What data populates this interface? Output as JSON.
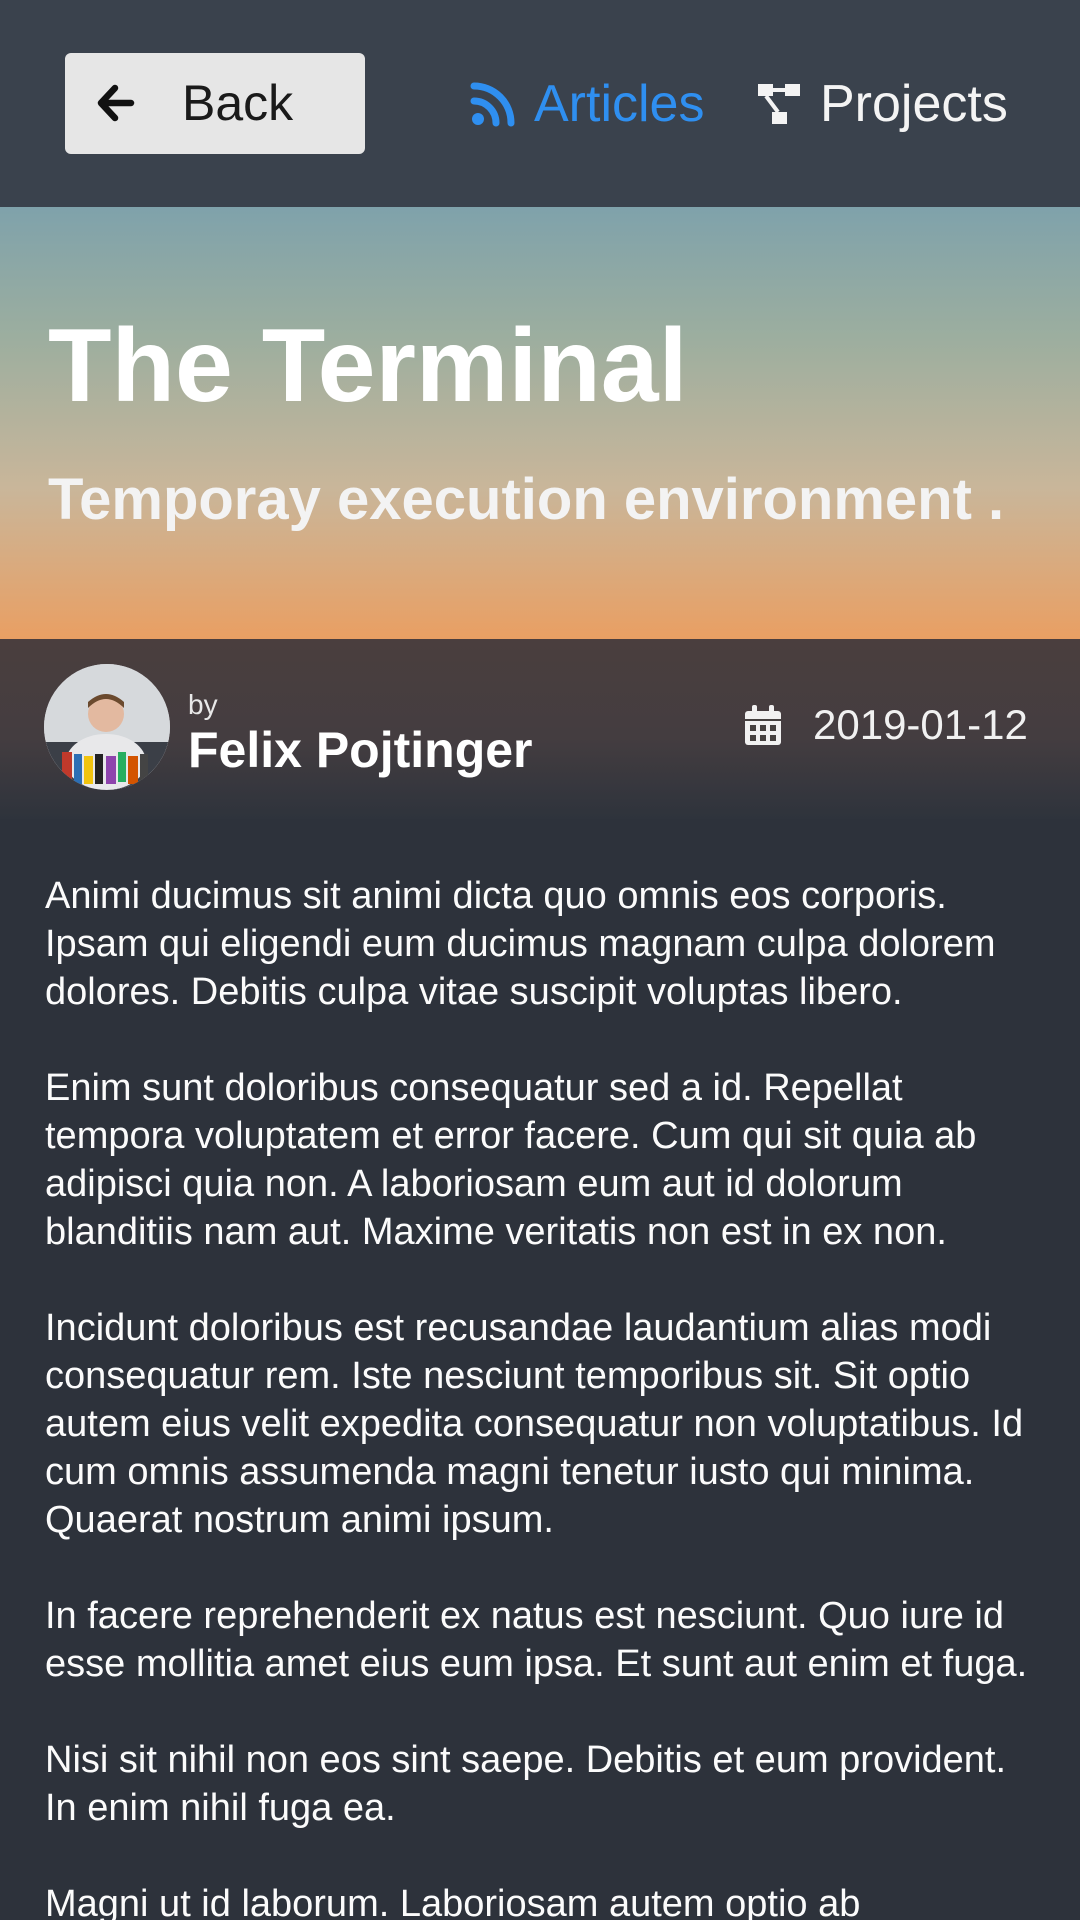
{
  "nav": {
    "back_label": "Back",
    "articles_label": "Articles",
    "projects_label": "Projects"
  },
  "hero": {
    "title": "The Terminal",
    "subtitle": "Temporay execution environment ."
  },
  "author": {
    "by_label": "by",
    "name": "Felix Pojtinger",
    "date": "2019-01-12"
  },
  "article": {
    "paragraphs": [
      "Animi ducimus sit animi dicta quo omnis eos corporis. Ipsam qui eligendi eum ducimus magnam culpa dolorem dolores. Debitis culpa vitae suscipit voluptas libero.",
      "Enim sunt doloribus consequatur sed a id. Repellat tempora voluptatem et error facere. Cum qui sit quia ab adipisci quia non. A laboriosam eum aut id dolorum blanditiis nam aut. Maxime veritatis non est in ex non.",
      "Incidunt doloribus est recusandae laudantium alias modi consequatur rem. Iste nesciunt temporibus sit. Sit optio autem eius velit expedita consequatur non voluptatibus. Id cum omnis assumenda magni tenetur iusto qui minima. Quaerat nostrum animi ipsum.",
      "In facere reprehenderit ex natus est nesciunt. Quo iure id esse mollitia amet eius eum ipsa. Et sunt aut enim et fuga.",
      "Nisi sit nihil non eos sint saepe. Debitis et eum provident. In enim nihil fuga ea.",
      "Magni ut id laborum. Laboriosam autem optio ab"
    ]
  },
  "icons": {
    "back": "arrow-left-icon",
    "articles": "rss-icon",
    "projects": "project-diagram-icon",
    "date": "calendar-icon"
  },
  "colors": {
    "accent": "#2f8ff0",
    "topbar": "#3a424d",
    "background": "#2d323b",
    "hero_top": "#7fa2ab",
    "hero_bottom": "#e99f63"
  }
}
